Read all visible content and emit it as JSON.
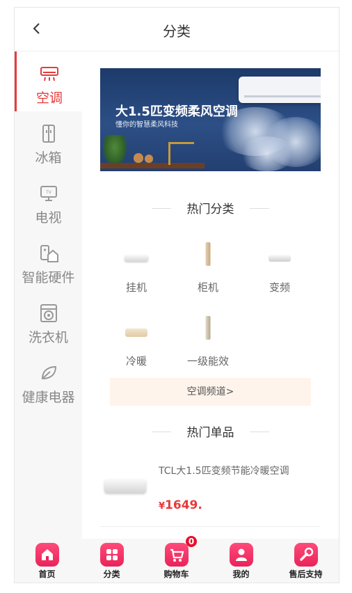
{
  "header": {
    "title": "分类"
  },
  "sidebar": {
    "items": [
      {
        "label": "空调",
        "icon": "air-conditioner-icon",
        "active": true
      },
      {
        "label": "冰箱",
        "icon": "fridge-icon",
        "active": false
      },
      {
        "label": "电视",
        "icon": "tv-icon",
        "active": false
      },
      {
        "label": "智能硬件",
        "icon": "smart-home-icon",
        "active": false
      },
      {
        "label": "洗衣机",
        "icon": "washing-machine-icon",
        "active": false
      },
      {
        "label": "健康电器",
        "icon": "leaf-icon",
        "active": false
      }
    ]
  },
  "banner": {
    "headline": "大1.5匹变频柔风空调",
    "subline": "懂你的智慧柔风科技"
  },
  "hot_categories": {
    "title": "热门分类",
    "items": [
      {
        "label": "挂机"
      },
      {
        "label": "柜机"
      },
      {
        "label": "变频"
      },
      {
        "label": "冷暖"
      },
      {
        "label": "一级能效"
      }
    ],
    "channel_link": "空调频道>"
  },
  "hot_products": {
    "title": "热门单品",
    "items": [
      {
        "name": "TCL大1.5匹变频节能冷暖空调",
        "price_symbol": "¥",
        "price": "1649",
        "price_decimal": "."
      }
    ]
  },
  "tabbar": {
    "items": [
      {
        "label": "首页",
        "icon": "home-icon"
      },
      {
        "label": "分类",
        "icon": "category-grid-icon"
      },
      {
        "label": "购物车",
        "icon": "cart-icon"
      },
      {
        "label": "我的",
        "icon": "user-icon"
      },
      {
        "label": "售后支持",
        "icon": "wrench-icon"
      }
    ],
    "cart_badge": "0"
  },
  "colors": {
    "accent": "#e83a3a",
    "tab_icon": "#ff3a6a",
    "channel_bg": "#fff4ec"
  }
}
